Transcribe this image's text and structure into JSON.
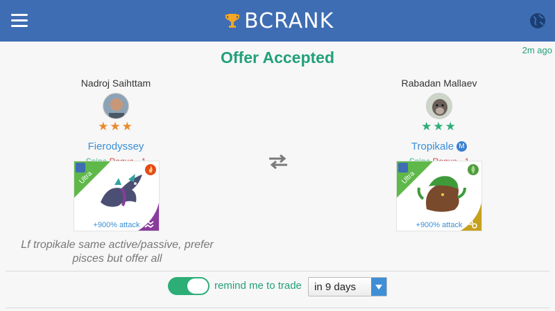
{
  "header": {
    "brand": "BCRANK"
  },
  "offer": {
    "title": "Offer Accepted",
    "time_ago": "2m ago"
  },
  "left": {
    "player_name": "Nadroj Saihttam",
    "stars": "★★★",
    "monster": "Fierodyssey",
    "tag1": "Snipe",
    "tag2": "Rogue · 1",
    "rarity": "Ultra",
    "attack": "+900% attack",
    "element": "fire",
    "sign": "aquarius"
  },
  "right": {
    "player_name": "Rabadan Mallaev",
    "stars": "★★★",
    "monster": "Tropikale",
    "badge": "M",
    "tag1": "Snipe",
    "tag2": "Rogue · 1",
    "rarity": "Ultra",
    "attack": "+900% attack",
    "element": "nature",
    "sign": "cancer"
  },
  "description": "Lf tropikale same active/passive, prefer pisces but offer all",
  "reminder": {
    "label": "remind me to trade",
    "enabled": true,
    "selected": "in 9 days"
  },
  "colors": {
    "header": "#3f6db3",
    "accent_green": "#22a07a",
    "link_blue": "#3a8ed6",
    "star_orange": "#e98a2c",
    "star_green": "#2dae77",
    "rogue_red": "#d04040"
  }
}
